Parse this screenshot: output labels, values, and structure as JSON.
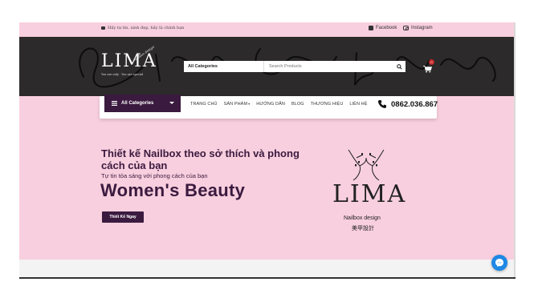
{
  "topbar": {
    "slogan": "Hãy tự tin, xinh đẹp, hãy là chính bạn",
    "facebook": "Facebook",
    "instagram": "Instagram"
  },
  "header": {
    "logo_text": "LIMA",
    "logo_script": "Nailbox design",
    "logo_tagline": "You are only · You are special",
    "search": {
      "category": "All Categories",
      "placeholder": "Search Products"
    },
    "cart_count": "0"
  },
  "nav": {
    "all_categories": "All Categories",
    "items": [
      "TRANG CHỦ",
      "SẢN PHẨM",
      "HƯỚNG DẪN",
      "BLOG",
      "THƯƠNG HIỆU",
      "LIÊN HỆ"
    ],
    "phone": "0862.036.867"
  },
  "hero": {
    "heading": "Thiết kế Nailbox theo sở thích và phong cách của bạn",
    "subheading": "Tự tin tỏa sáng với phong cách của bạn",
    "big": "Women's Beauty",
    "cta": "Thiết Kế Ngay",
    "brand": {
      "name": "LIMA",
      "caption": "Nailbox design",
      "jp": "美甲設計"
    }
  },
  "colors": {
    "pink": "#f8cfde",
    "dark": "#2c2a2a",
    "plum": "#3b1a3f",
    "messenger": "#1e88e5"
  }
}
